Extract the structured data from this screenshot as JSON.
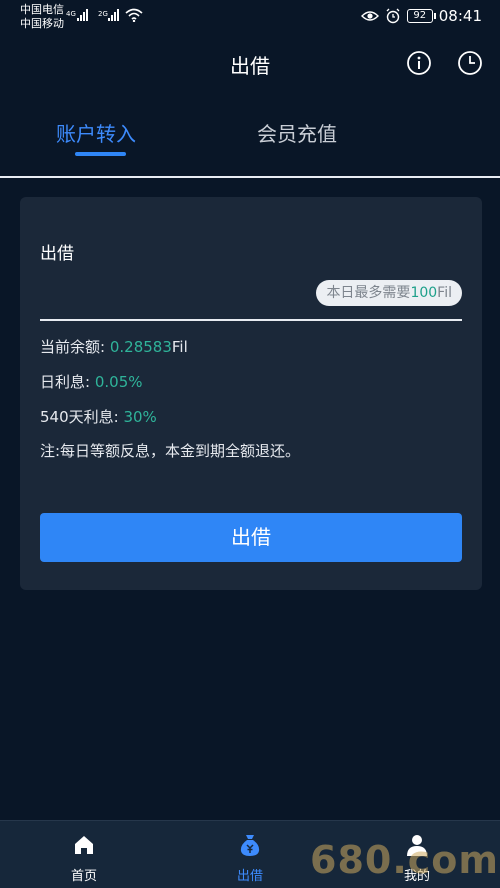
{
  "status_bar": {
    "carrier_1": "中国电信",
    "carrier_2": "中国移动",
    "net_1": "4G",
    "net_2": "2G",
    "battery": "92",
    "time": "08:41"
  },
  "header": {
    "title": "出借",
    "info_icon": "info-circle-icon",
    "history_icon": "clock-icon"
  },
  "tabs": [
    {
      "label": "账户转入",
      "active": true
    },
    {
      "label": "会员充值",
      "active": false
    }
  ],
  "form": {
    "section_label": "出借",
    "amount_value": "",
    "max_prefix": "本日最多需要",
    "max_amount": "100",
    "max_unit": "Fil",
    "balance_label": "当前余额:",
    "balance_value": "0.28583",
    "balance_unit": "Fil",
    "daily_rate_label": "日利息:",
    "daily_rate_value": "0.05%",
    "term_rate_label": "540天利息:",
    "term_rate_value": "30%",
    "note": "注:每日等额反息，本金到期全额退还。",
    "submit_label": "出借"
  },
  "bottom_nav": [
    {
      "label": "首页",
      "icon": "home-icon",
      "active": false
    },
    {
      "label": "出借",
      "icon": "money-bag-icon",
      "active": true
    },
    {
      "label": "我的",
      "icon": "user-icon",
      "active": false
    }
  ],
  "watermark": "680.com",
  "colors": {
    "background": "#091627",
    "card": "#1b2839",
    "accent": "#2f86f6",
    "highlight_green": "#2fb49a"
  }
}
